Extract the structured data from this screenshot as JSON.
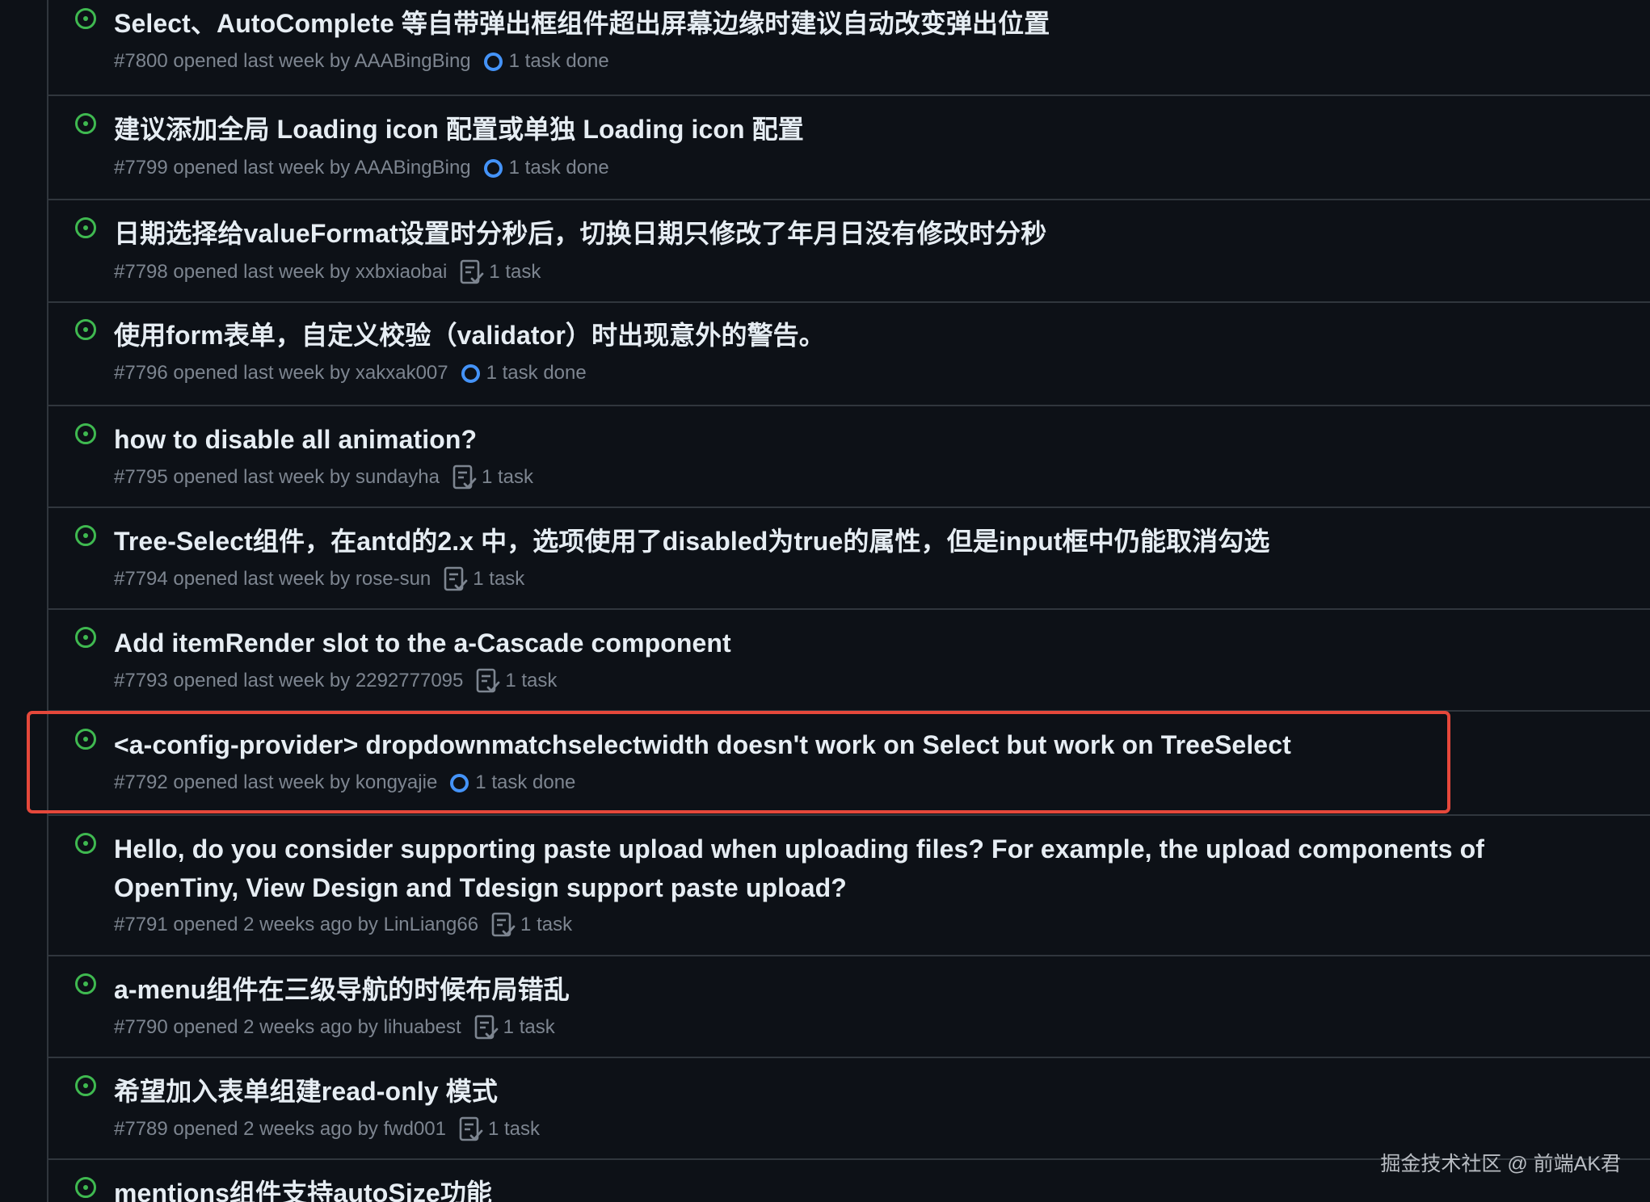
{
  "colors": {
    "background": "#0d1117",
    "row_border": "#30363d",
    "title_text": "#e6edf3",
    "meta_text": "#7d8590",
    "open_icon": "#3fb950",
    "progress_ring": "#4493f8",
    "highlight": "#e5483b"
  },
  "icons": {
    "status": "issue-opened-icon",
    "done_tasks": "progress-circle-icon",
    "open_tasks": "checklist-icon"
  },
  "issues": [
    {
      "title": "Select、AutoComplete 等自带弹出框组件超出屏幕边缘时建议自动改变弹出位置",
      "meta": "#7800 opened last week by AAABingBing",
      "task": "1 task done",
      "task_icon": "progress-circle-icon"
    },
    {
      "title": "建议添加全局 Loading icon 配置或单独 Loading icon 配置",
      "meta": "#7799 opened last week by AAABingBing",
      "task": "1 task done",
      "task_icon": "progress-circle-icon"
    },
    {
      "title": "日期选择给valueFormat设置时分秒后，切换日期只修改了年月日没有修改时分秒",
      "meta": "#7798 opened last week by xxbxiaobai",
      "task": "1 task",
      "task_icon": "checklist-icon"
    },
    {
      "title": "使用form表单，自定义校验（validator）时出现意外的警告。",
      "meta": "#7796 opened last week by xakxak007",
      "task": "1 task done",
      "task_icon": "progress-circle-icon"
    },
    {
      "title": "how to disable all animation?",
      "meta": "#7795 opened last week by sundayha",
      "task": "1 task",
      "task_icon": "checklist-icon"
    },
    {
      "title": "Tree-Select组件，在antd的2.x 中，选项使用了disabled为true的属性，但是input框中仍能取消勾选",
      "meta": "#7794 opened last week by rose-sun",
      "task": "1 task",
      "task_icon": "checklist-icon"
    },
    {
      "title": "Add itemRender slot to the a-Cascade component",
      "meta": "#7793 opened last week by 2292777095",
      "task": "1 task",
      "task_icon": "checklist-icon"
    },
    {
      "title": "<a-config-provider> dropdownmatchselectwidth doesn't work on Select but work on TreeSelect",
      "meta": "#7792 opened last week by kongyajie",
      "task": "1 task done",
      "task_icon": "progress-circle-icon",
      "highlighted": true
    },
    {
      "title": "Hello, do you consider supporting paste upload when uploading files? For example, the upload components of OpenTiny, View Design and Tdesign support paste upload?",
      "meta": "#7791 opened 2 weeks ago by LinLiang66",
      "task": "1 task",
      "task_icon": "checklist-icon"
    },
    {
      "title": "a-menu组件在三级导航的时候布局错乱",
      "meta": "#7790 opened 2 weeks ago by lihuabest",
      "task": "1 task",
      "task_icon": "checklist-icon"
    },
    {
      "title": "希望加入表单组建read-only 模式",
      "meta": "#7789 opened 2 weeks ago by fwd001",
      "task": "1 task",
      "task_icon": "checklist-icon"
    },
    {
      "title": "mentions组件支持autoSize功能"
    }
  ],
  "watermark": "掘金技术社区 @ 前端AK君"
}
